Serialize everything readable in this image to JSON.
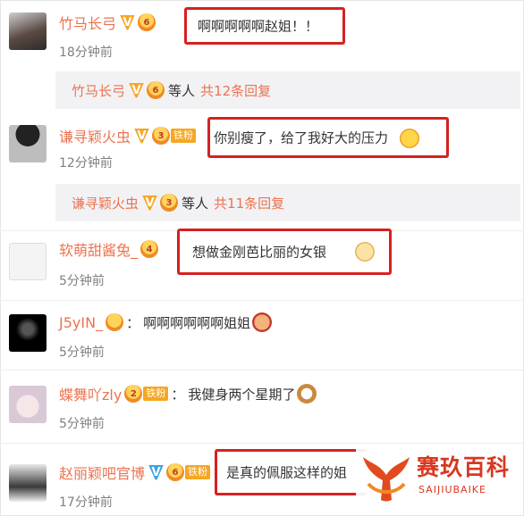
{
  "comments": [
    {
      "username": "竹马长弓",
      "level": "6",
      "fan_badge": "",
      "text": "啊啊啊啊啊赵姐！！",
      "time": "18分钟前"
    },
    {
      "username": "谦寻颖火虫",
      "level": "3",
      "fan_badge": "铁粉",
      "text": "你别瘦了，给了我好大的压力",
      "time": "12分钟前"
    },
    {
      "username": "软萌甜酱兔_",
      "level": "4",
      "fan_badge": "",
      "text": "想做金刚芭比丽的女银",
      "time": "5分钟前"
    },
    {
      "username": "J5yIN_",
      "level": "",
      "fan_badge": "",
      "text": "啊啊啊啊啊啊姐姐",
      "time": "5分钟前"
    },
    {
      "username": "蝶舞吖zly",
      "level": "2",
      "fan_badge": "铁粉",
      "text": "我健身两个星期了",
      "time": "5分钟前"
    },
    {
      "username": "赵丽颖吧官博",
      "level": "6",
      "fan_badge": "铁粉",
      "text": "是真的佩服这样的姐",
      "time": "17分钟前"
    }
  ],
  "replies": [
    {
      "username": "竹马长弓",
      "etc": "等人",
      "count": "共12条回复"
    },
    {
      "username": "谦寻颖火虫",
      "etc": "等人",
      "count": "共11条回复"
    }
  ],
  "colon": "：",
  "v_mark": "V",
  "watermark": {
    "cn": "赛玖百科",
    "en": "SAIJIUBAIKE"
  },
  "colors": {
    "username": "#eb7350",
    "highlight": "#d42220",
    "watermark": "#d9371f"
  }
}
